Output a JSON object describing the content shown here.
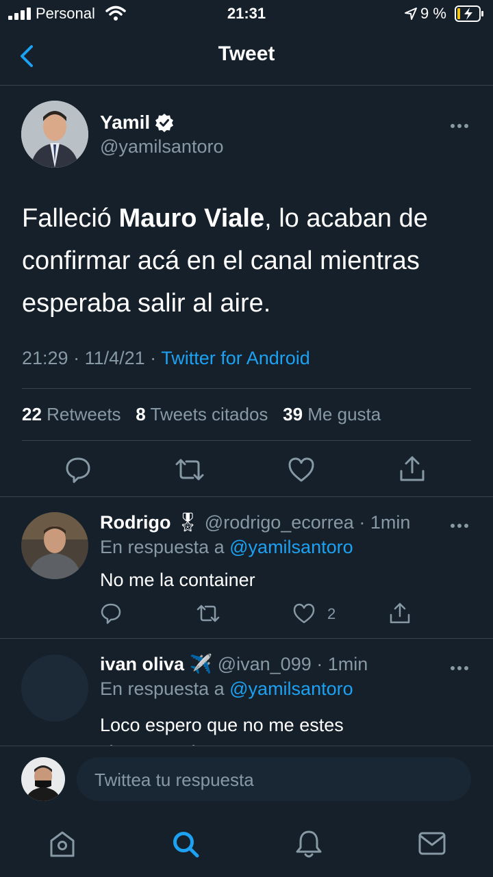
{
  "status_bar": {
    "carrier": "Personal",
    "time": "21:31",
    "battery": "9 %"
  },
  "header": {
    "title": "Tweet"
  },
  "main_tweet": {
    "name": "Yamil",
    "handle": "@yamilsantoro",
    "text_before": "Falleció ",
    "text_bold": "Mauro Viale",
    "text_after": ", lo acaban de confirmar acá en el canal mientras esperaba salir al aire.",
    "time": "21:29",
    "date": "11/4/21",
    "source": "Twitter for Android",
    "retweets_count": "22",
    "retweets_label": "Retweets",
    "quotes_count": "8",
    "quotes_label": "Tweets citados",
    "likes_count": "39",
    "likes_label": "Me gusta"
  },
  "replies": [
    {
      "name": "Rodrigo",
      "emoji": "🎖",
      "handle": "@rodrigo_ecorrea",
      "age": "1min",
      "reply_to_label": "En respuesta a",
      "reply_to_handle": "@yamilsantoro",
      "text": "No me la container",
      "likes": "2"
    },
    {
      "name": "ivan oliva",
      "emoji": "✈️",
      "handle": "@ivan_099",
      "age": "1min",
      "reply_to_label": "En respuesta a",
      "reply_to_handle": "@yamilsantoro",
      "text": "Loco espero que no me estes chamuyando"
    }
  ],
  "composer": {
    "placeholder": "Twittea tu respuesta"
  },
  "colors": {
    "background": "#15202b",
    "accent": "#1da1f2",
    "muted": "#8899a6",
    "divider": "#38444d"
  },
  "icons": {
    "bottom_nav": [
      "home-icon",
      "search-icon",
      "notifications-icon",
      "messages-icon"
    ],
    "actions": [
      "reply-icon",
      "retweet-icon",
      "like-icon",
      "share-icon"
    ]
  }
}
